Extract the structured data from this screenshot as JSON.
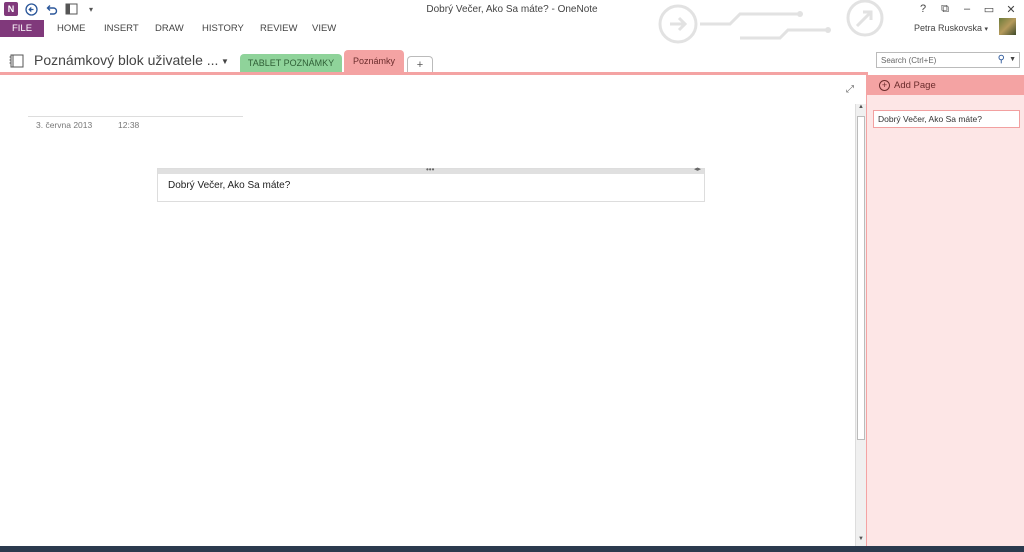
{
  "window": {
    "title": "Dobrý Večer, Ako Sa máte? - OneNote",
    "controls": [
      "?",
      "⧉",
      "–",
      "▭",
      "✕"
    ]
  },
  "qat": {
    "app_icon_label": "N",
    "back_icon": "back-arrow-icon",
    "undo_icon": "undo-icon",
    "dock_icon": "dock-icon",
    "customize_icon": "customize-qat-icon"
  },
  "ribbon": {
    "tabs": [
      "FILE",
      "HOME",
      "INSERT",
      "DRAW",
      "HISTORY",
      "REVIEW",
      "VIEW"
    ],
    "user_name": "Petra Ruskovska"
  },
  "notebook": {
    "title": "Poznámkový blok uživatele ...",
    "sections": [
      {
        "label": "TABLET POZNÁMKY",
        "color": "#8fd39a"
      },
      {
        "label": "Poznámky",
        "color": "#f4a3a3",
        "active": true
      }
    ],
    "add_section_label": "+"
  },
  "search": {
    "placeholder": "Search (Ctrl+E)"
  },
  "page": {
    "date": "3. června 2013",
    "time": "12:38",
    "note_text": "Dobrý Večer, Ako Sa máte?"
  },
  "pages_pane": {
    "add_page_label": "Add Page",
    "pages": [
      "Dobrý Večer, Ako Sa máte?"
    ]
  },
  "colors": {
    "onenote_purple": "#80397b",
    "section_pink": "#f4a3a3",
    "section_green": "#8fd39a",
    "pane_bg": "#fde6e6"
  }
}
